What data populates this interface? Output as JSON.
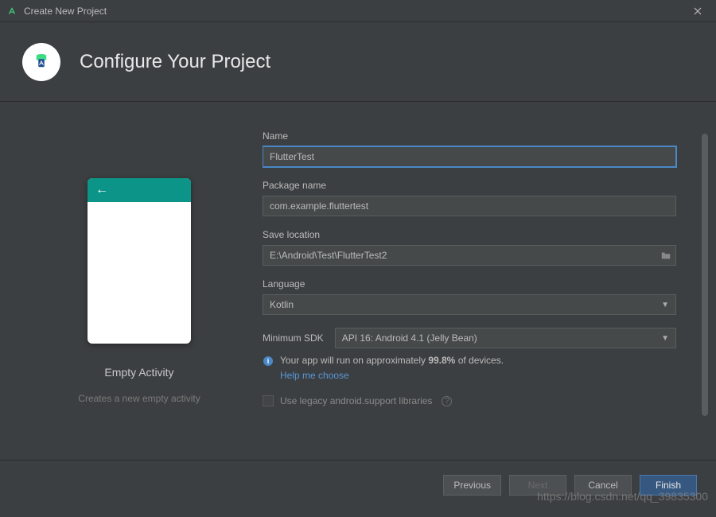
{
  "window": {
    "title": "Create New Project"
  },
  "header": {
    "title": "Configure Your Project"
  },
  "preview": {
    "template_name": "Empty Activity",
    "template_desc": "Creates a new empty activity"
  },
  "form": {
    "name_label": "Name",
    "name_value": "FlutterTest",
    "package_label": "Package name",
    "package_value": "com.example.fluttertest",
    "location_label": "Save location",
    "location_value": "E:\\Android\\Test\\FlutterTest2",
    "language_label": "Language",
    "language_value": "Kotlin",
    "sdk_label": "Minimum SDK",
    "sdk_value": "API 16: Android 4.1 (Jelly Bean)",
    "info_prefix": "Your app will run on approximately ",
    "info_pct": "99.8%",
    "info_suffix": " of devices.",
    "help_link": "Help me choose",
    "legacy_label": "Use legacy android.support libraries"
  },
  "footer": {
    "previous": "Previous",
    "next": "Next",
    "cancel": "Cancel",
    "finish": "Finish"
  },
  "watermark": "https://blog.csdn.net/qq_39835300"
}
